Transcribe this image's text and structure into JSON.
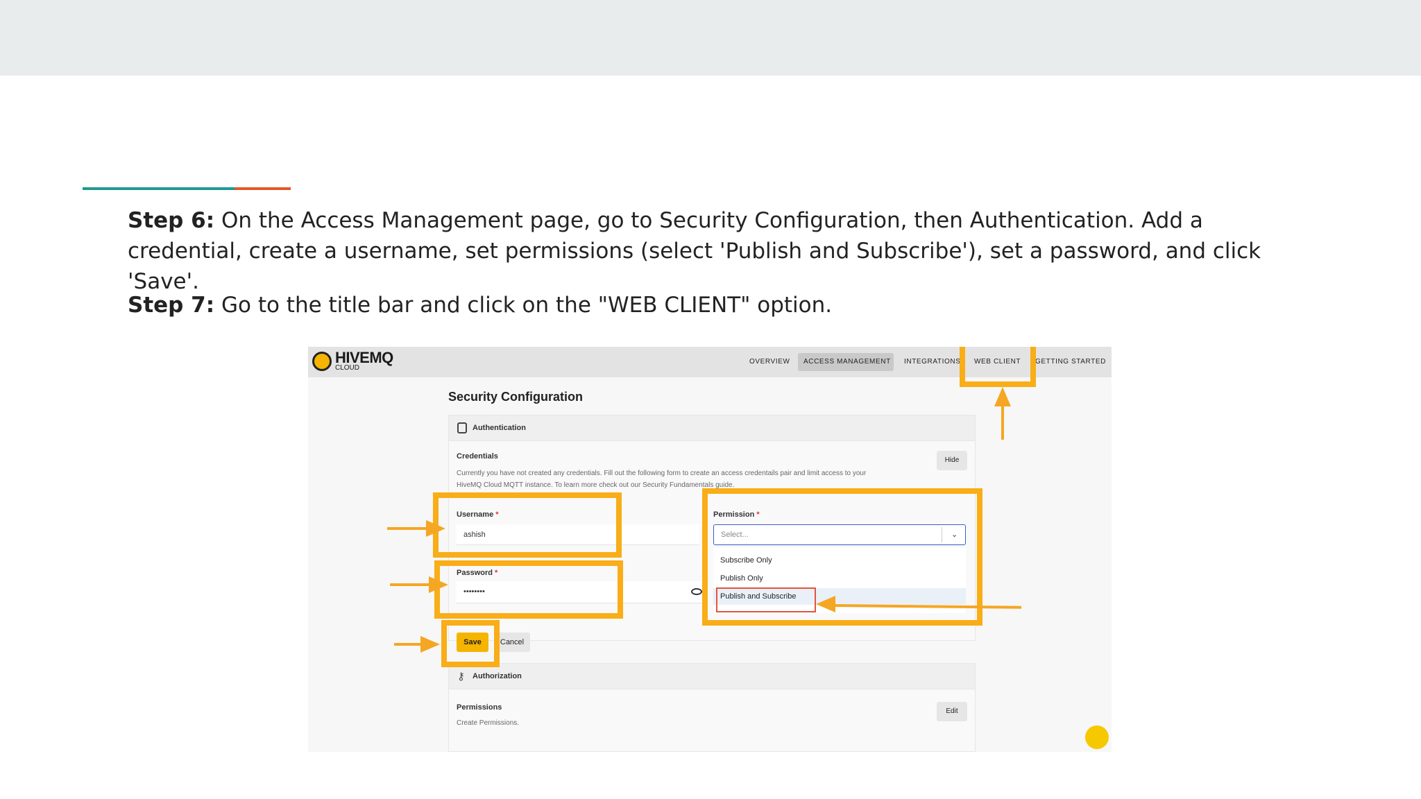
{
  "instructions": {
    "step6_label": "Step 6:",
    "step6_text": " On the Access Management page, go to Security Configuration, then Authentication. Add a credential, create a username, set permissions (select 'Publish and Subscribe'), set a password, and click 'Save'.",
    "step7_label": "Step 7:",
    "step7_text": " Go to the title bar and click on the \"WEB CLIENT\" option."
  },
  "app": {
    "logo_text": "HIVEMQ",
    "logo_sub": "CLOUD",
    "nav": [
      "OVERVIEW",
      "ACCESS MANAGEMENT",
      "INTEGRATIONS",
      "WEB CLIENT",
      "GETTING STARTED"
    ],
    "active_nav": "ACCESS MANAGEMENT",
    "page_title": "Security Configuration",
    "authentication_title": "Authentication",
    "credentials_title": "Credentials",
    "credentials_hint_1": "Currently you have not created any credentials. Fill out the following form to create an access credentails pair and limit access to your",
    "credentials_hint_2": "HiveMQ Cloud MQTT instance. To learn more check out our Security Fundamentals guide.",
    "hide_button": "Hide",
    "username_label": "Username",
    "username_value": "ashish",
    "password_label": "Password",
    "password_value": "••••••••",
    "required_mark": "*",
    "permission_label": "Permission",
    "permission_placeholder": "Select...",
    "permission_options": [
      "Subscribe Only",
      "Publish Only",
      "Publish and Subscribe"
    ],
    "save_button": "Save",
    "cancel_button": "Cancel",
    "authorization_title": "Authorization",
    "permissions_title": "Permissions",
    "permissions_hint": "Create Permissions.",
    "edit_button": "Edit"
  },
  "colors": {
    "highlight": "#f9ad17",
    "save_button": "#f5b400",
    "selected_outline": "#e5533d"
  }
}
